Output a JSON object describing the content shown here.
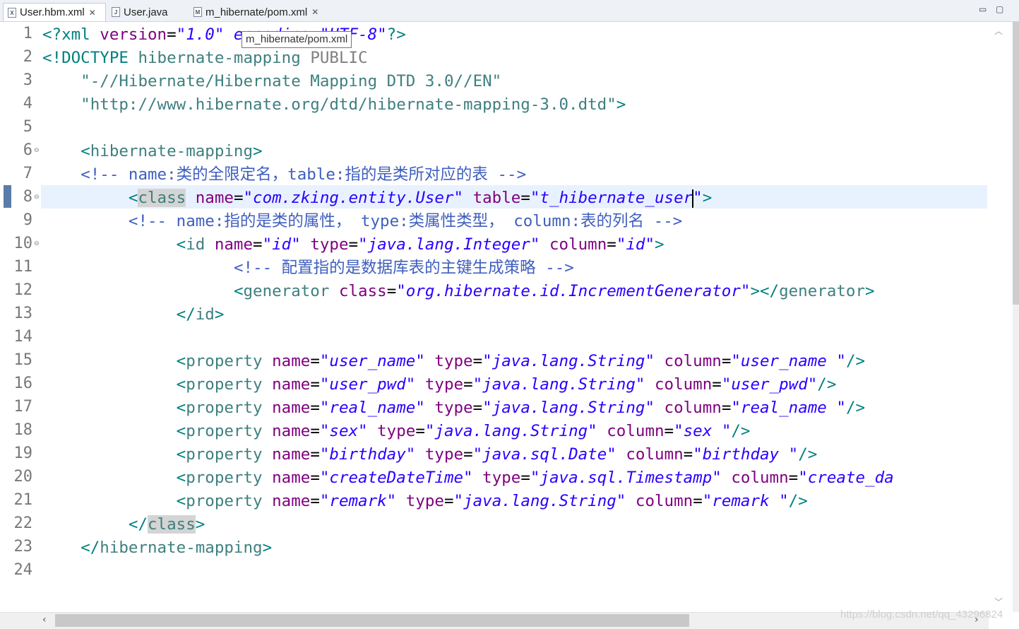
{
  "tabs": [
    {
      "label": "User.hbm.xml",
      "icon": "xml-file-icon",
      "closable": true
    },
    {
      "label": "User.java",
      "icon": "java-file-icon",
      "closable": false
    },
    {
      "label": "m_hibernate/pom.xml",
      "icon": "maven-pom-icon",
      "closable": true
    }
  ],
  "tooltip": "m_hibernate/pom.xml",
  "line_numbers": [
    "1",
    "2",
    "3",
    "4",
    "5",
    "6",
    "7",
    "8",
    "9",
    "10",
    "11",
    "12",
    "13",
    "14",
    "15",
    "16",
    "17",
    "18",
    "19",
    "20",
    "21",
    "22",
    "23",
    "24"
  ],
  "current_line": 8,
  "lines": [
    [
      [
        "p",
        "<?xml "
      ],
      [
        "a",
        "version"
      ],
      [
        "d",
        "="
      ],
      [
        "v",
        "\"1.0\" encoding=\"UTF-8\""
      ],
      [
        "p",
        "?>"
      ]
    ],
    [
      [
        "p",
        "<!DOCTYPE "
      ],
      [
        "t",
        "hibernate-mapping "
      ],
      [
        "k",
        "PUBLIC"
      ]
    ],
    [
      [
        "d",
        "    "
      ],
      [
        "t",
        "\"-//Hibernate/Hibernate Mapping DTD 3.0//EN\""
      ]
    ],
    [
      [
        "d",
        "    "
      ],
      [
        "t",
        "\"http://www.hibernate.org/dtd/hibernate-mapping-3.0.dtd\""
      ],
      [
        "p",
        ">"
      ]
    ],
    [
      [
        "d",
        ""
      ]
    ],
    [
      [
        "d",
        "    "
      ],
      [
        "b",
        "<"
      ],
      [
        "t",
        "hibernate-mapping"
      ],
      [
        "b",
        ">"
      ]
    ],
    [
      [
        "d",
        "    "
      ],
      [
        "c",
        "<!-- name:类的全限定名，table:指的是类所对应的表 -->"
      ]
    ],
    [
      [
        "d",
        "         "
      ],
      [
        "b",
        "<"
      ],
      [
        "t",
        "class"
      ],
      [
        "d",
        " "
      ],
      [
        "a",
        "name"
      ],
      [
        "d",
        "="
      ],
      [
        "v",
        "\"com.zking.entity.User\""
      ],
      [
        "d",
        " "
      ],
      [
        "a",
        "table"
      ],
      [
        "d",
        "="
      ],
      [
        "v",
        "\"t_hibernate_user\""
      ],
      [
        "b",
        ">"
      ]
    ],
    [
      [
        "d",
        "         "
      ],
      [
        "c",
        "<!-- name:指的是类的属性， type:类属性类型， column:表的列名 -->"
      ]
    ],
    [
      [
        "d",
        "              "
      ],
      [
        "b",
        "<"
      ],
      [
        "t",
        "id"
      ],
      [
        "d",
        " "
      ],
      [
        "a",
        "name"
      ],
      [
        "d",
        "="
      ],
      [
        "v",
        "\"id\""
      ],
      [
        "d",
        " "
      ],
      [
        "a",
        "type"
      ],
      [
        "d",
        "="
      ],
      [
        "v",
        "\"java.lang.Integer\""
      ],
      [
        "d",
        " "
      ],
      [
        "a",
        "column"
      ],
      [
        "d",
        "="
      ],
      [
        "v",
        "\"id\""
      ],
      [
        "b",
        ">"
      ]
    ],
    [
      [
        "d",
        "                    "
      ],
      [
        "c",
        "<!-- 配置指的是数据库表的主键生成策略 -->"
      ]
    ],
    [
      [
        "d",
        "                    "
      ],
      [
        "b",
        "<"
      ],
      [
        "t",
        "generator"
      ],
      [
        "d",
        " "
      ],
      [
        "a",
        "class"
      ],
      [
        "d",
        "="
      ],
      [
        "v",
        "\"org.hibernate.id.IncrementGenerator\""
      ],
      [
        "b",
        "></"
      ],
      [
        "t",
        "generator"
      ],
      [
        "b",
        ">"
      ]
    ],
    [
      [
        "d",
        "              "
      ],
      [
        "b",
        "</"
      ],
      [
        "t",
        "id"
      ],
      [
        "b",
        ">"
      ]
    ],
    [
      [
        "d",
        ""
      ]
    ],
    [
      [
        "d",
        "              "
      ],
      [
        "b",
        "<"
      ],
      [
        "t",
        "property"
      ],
      [
        "d",
        " "
      ],
      [
        "a",
        "name"
      ],
      [
        "d",
        "="
      ],
      [
        "v",
        "\"user_name\""
      ],
      [
        "d",
        " "
      ],
      [
        "a",
        "type"
      ],
      [
        "d",
        "="
      ],
      [
        "v",
        "\"java.lang.String\""
      ],
      [
        "d",
        " "
      ],
      [
        "a",
        "column"
      ],
      [
        "d",
        "="
      ],
      [
        "v",
        "\"user_name \""
      ],
      [
        "b",
        "/>"
      ]
    ],
    [
      [
        "d",
        "              "
      ],
      [
        "b",
        "<"
      ],
      [
        "t",
        "property"
      ],
      [
        "d",
        " "
      ],
      [
        "a",
        "name"
      ],
      [
        "d",
        "="
      ],
      [
        "v",
        "\"user_pwd\""
      ],
      [
        "d",
        " "
      ],
      [
        "a",
        "type"
      ],
      [
        "d",
        "="
      ],
      [
        "v",
        "\"java.lang.String\""
      ],
      [
        "d",
        " "
      ],
      [
        "a",
        "column"
      ],
      [
        "d",
        "="
      ],
      [
        "v",
        "\"user_pwd\""
      ],
      [
        "b",
        "/>"
      ]
    ],
    [
      [
        "d",
        "              "
      ],
      [
        "b",
        "<"
      ],
      [
        "t",
        "property"
      ],
      [
        "d",
        " "
      ],
      [
        "a",
        "name"
      ],
      [
        "d",
        "="
      ],
      [
        "v",
        "\"real_name\""
      ],
      [
        "d",
        " "
      ],
      [
        "a",
        "type"
      ],
      [
        "d",
        "="
      ],
      [
        "v",
        "\"java.lang.String\""
      ],
      [
        "d",
        " "
      ],
      [
        "a",
        "column"
      ],
      [
        "d",
        "="
      ],
      [
        "v",
        "\"real_name \""
      ],
      [
        "b",
        "/>"
      ]
    ],
    [
      [
        "d",
        "              "
      ],
      [
        "b",
        "<"
      ],
      [
        "t",
        "property"
      ],
      [
        "d",
        " "
      ],
      [
        "a",
        "name"
      ],
      [
        "d",
        "="
      ],
      [
        "v",
        "\"sex\""
      ],
      [
        "d",
        " "
      ],
      [
        "a",
        "type"
      ],
      [
        "d",
        "="
      ],
      [
        "v",
        "\"java.lang.String\""
      ],
      [
        "d",
        " "
      ],
      [
        "a",
        "column"
      ],
      [
        "d",
        "="
      ],
      [
        "v",
        "\"sex \""
      ],
      [
        "b",
        "/>"
      ]
    ],
    [
      [
        "d",
        "              "
      ],
      [
        "b",
        "<"
      ],
      [
        "t",
        "property"
      ],
      [
        "d",
        " "
      ],
      [
        "a",
        "name"
      ],
      [
        "d",
        "="
      ],
      [
        "v",
        "\"birthday\""
      ],
      [
        "d",
        " "
      ],
      [
        "a",
        "type"
      ],
      [
        "d",
        "="
      ],
      [
        "v",
        "\"java.sql.Date\""
      ],
      [
        "d",
        " "
      ],
      [
        "a",
        "column"
      ],
      [
        "d",
        "="
      ],
      [
        "v",
        "\"birthday \""
      ],
      [
        "b",
        "/>"
      ]
    ],
    [
      [
        "d",
        "              "
      ],
      [
        "b",
        "<"
      ],
      [
        "t",
        "property"
      ],
      [
        "d",
        " "
      ],
      [
        "a",
        "name"
      ],
      [
        "d",
        "="
      ],
      [
        "v",
        "\"createDateTime\""
      ],
      [
        "d",
        " "
      ],
      [
        "a",
        "type"
      ],
      [
        "d",
        "="
      ],
      [
        "v",
        "\"java.sql.Timestamp\""
      ],
      [
        "d",
        " "
      ],
      [
        "a",
        "column"
      ],
      [
        "d",
        "="
      ],
      [
        "v",
        "\"create_da"
      ]
    ],
    [
      [
        "d",
        "              "
      ],
      [
        "b",
        "<"
      ],
      [
        "t",
        "property"
      ],
      [
        "d",
        " "
      ],
      [
        "a",
        "name"
      ],
      [
        "d",
        "="
      ],
      [
        "v",
        "\"remark\""
      ],
      [
        "d",
        " "
      ],
      [
        "a",
        "type"
      ],
      [
        "d",
        "="
      ],
      [
        "v",
        "\"java.lang.String\""
      ],
      [
        "d",
        " "
      ],
      [
        "a",
        "column"
      ],
      [
        "d",
        "="
      ],
      [
        "v",
        "\"remark \""
      ],
      [
        "b",
        "/>"
      ]
    ],
    [
      [
        "d",
        "         "
      ],
      [
        "b",
        "</"
      ],
      [
        "t",
        "class"
      ],
      [
        "b",
        ">"
      ]
    ],
    [
      [
        "d",
        "    "
      ],
      [
        "b",
        "</"
      ],
      [
        "t",
        "hibernate-mapping"
      ],
      [
        "b",
        ">"
      ]
    ],
    [
      [
        "d",
        ""
      ]
    ]
  ],
  "fold_lines": [
    6,
    8,
    10
  ],
  "watermark": "https://blog.csdn.net/qq_43296824"
}
